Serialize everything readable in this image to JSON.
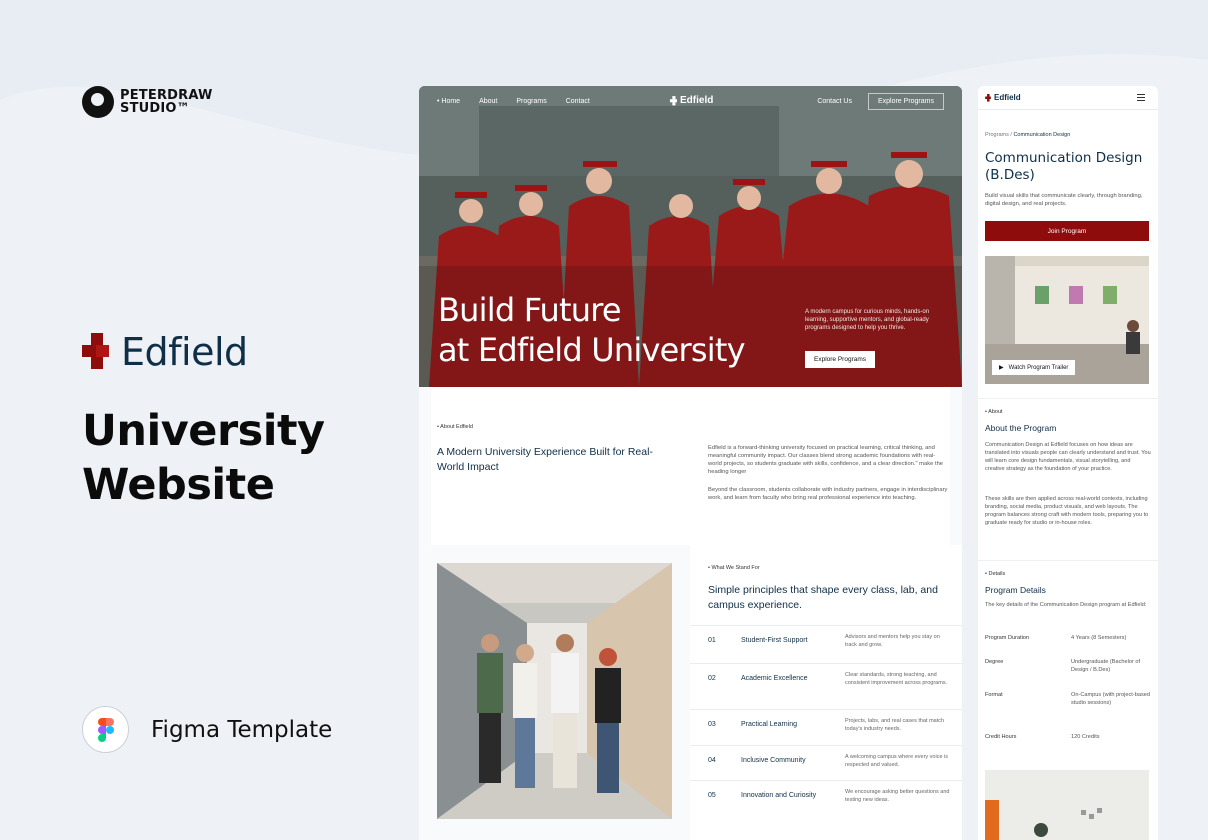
{
  "studio": {
    "line1": "PETERDRAW",
    "line2": "STUDIO™"
  },
  "brand": {
    "name": "Edfield"
  },
  "headline": {
    "line1": "University",
    "line2": "Website"
  },
  "figma": {
    "label": "Figma Template"
  },
  "desktop": {
    "nav": {
      "items": [
        "• Home",
        "About",
        "Programs",
        "Contact"
      ],
      "brand": "Edfield",
      "contact": "Contact Us",
      "cta": "Explore Programs"
    },
    "hero": {
      "title_line1": "Build Future",
      "title_line2": "at Edfield University",
      "desc": "A modern campus for curious minds, hands-on learning, supportive mentors, and global-ready programs designed to help you thrive.",
      "button": "Explore Programs"
    },
    "about": {
      "tag": "About Edfield",
      "heading": "A Modern University Experience Built for Real-World Impact",
      "p1": "Edfield is a forward-thinking university focused on practical learning, critical thinking, and meaningful community impact. Our classes blend strong academic foundations with real-world projects, so students graduate with skills, confidence, and a clear direction.\" make the heading longer",
      "p2": "Beyond the classroom, students collaborate with industry partners, engage in interdisciplinary work, and learn from faculty who bring real professional experience into teaching."
    },
    "values": {
      "tag": "What We Stand For",
      "heading": "Simple principles that shape every class, lab, and campus experience.",
      "rows": [
        {
          "num": "01",
          "title": "Student-First Support",
          "desc": "Advisors and mentors help you stay on track and grow."
        },
        {
          "num": "02",
          "title": "Academic Excellence",
          "desc": "Clear standards, strong teaching, and consistent improvement across programs."
        },
        {
          "num": "03",
          "title": "Practical Learning",
          "desc": "Projects, labs, and real cases that match today's industry needs."
        },
        {
          "num": "04",
          "title": "Inclusive Community",
          "desc": "A welcoming campus where every voice is respected and valued."
        },
        {
          "num": "05",
          "title": "Innovation and Curiosity",
          "desc": "We encourage asking better questions and testing new ideas."
        }
      ]
    }
  },
  "mobile": {
    "brand": "Edfield",
    "crumb_root": "Programs",
    "crumb_sep": "/",
    "crumb_current": "Communication Design",
    "title": "Communication Design (B.Des)",
    "subtitle": "Build visual skills that communicate clearly, through branding, digital design, and real projects.",
    "join": "Join Program",
    "trailer": "Watch Program Trailer",
    "about": {
      "tag": "About",
      "heading": "About the Program",
      "p1": "Communication Design at Edfield focuses on how ideas are translated into visuals people can clearly understand and trust. You will learn core design fundamentals, visual storytelling, and creative strategy as the foundation of your practice.",
      "p2": "These skills are then applied across real-world contexts, including branding, social media, product visuals, and web layouts. The program balances strong craft with modern tools, preparing you to graduate ready for studio or in-house roles."
    },
    "details": {
      "tag": "Details",
      "heading": "Program Details",
      "intro": "The key details of the Communication Design program at Edfield:",
      "rows": [
        {
          "key": "Program Duration",
          "value": "4 Years (8 Semesters)"
        },
        {
          "key": "Degree",
          "value": "Undergraduate (Bachelor of Design / B.Des)"
        },
        {
          "key": "Format",
          "value": "On-Campus (with project-based studio sessions)"
        },
        {
          "key": "Credit Hours",
          "value": "120 Credits"
        }
      ]
    }
  },
  "colors": {
    "accent": "#8f0c0c",
    "navy": "#0f2f47",
    "background": "#eef2f6"
  }
}
